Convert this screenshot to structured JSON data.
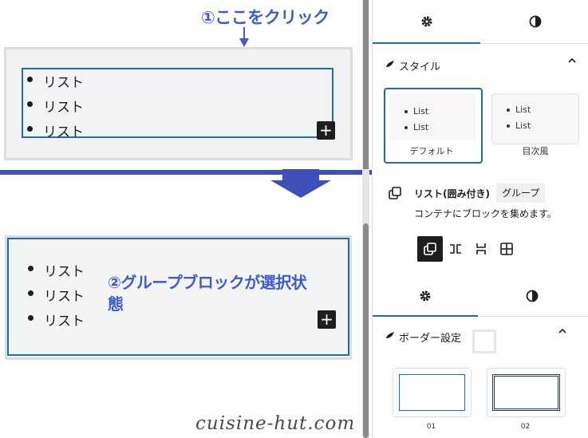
{
  "annotations": {
    "step1": "①ここをクリック",
    "step2": "②グループブロックが選択状態"
  },
  "canvas": {
    "list_items_before": [
      "リスト",
      "リスト",
      "リスト"
    ],
    "list_items_after": [
      "リスト",
      "リスト",
      "リスト"
    ],
    "add_block_label": "+"
  },
  "sidebar_top": {
    "tabs": [
      {
        "icon": "gear-icon",
        "active": true
      },
      {
        "icon": "contrast-icon",
        "active": false
      }
    ],
    "styles_title": "スタイル",
    "style_cards": [
      {
        "label": "デフォルト",
        "items": [
          "List",
          "List"
        ],
        "selected": true
      },
      {
        "label": "目次風",
        "items": [
          "List",
          "List"
        ],
        "selected": false
      }
    ]
  },
  "sidebar_bottom": {
    "block_name": "リスト(囲み付き)",
    "block_tag": "グループ",
    "block_desc": "コンテナにブロックを集めます。",
    "variations": [
      "group-icon",
      "row-icon",
      "stack-icon",
      "grid-icon"
    ],
    "tabs": [
      {
        "icon": "gear-icon",
        "active": true
      },
      {
        "icon": "contrast-icon",
        "active": false
      }
    ],
    "border_title": "ボーダー設定",
    "border_cards": [
      {
        "label": "01"
      },
      {
        "label": "02"
      }
    ]
  },
  "watermark": "cuisine-hut.com",
  "colors": {
    "accent": "#1e6bb8",
    "annotation": "#3f5bd4",
    "divider": "#3d4fb8"
  }
}
